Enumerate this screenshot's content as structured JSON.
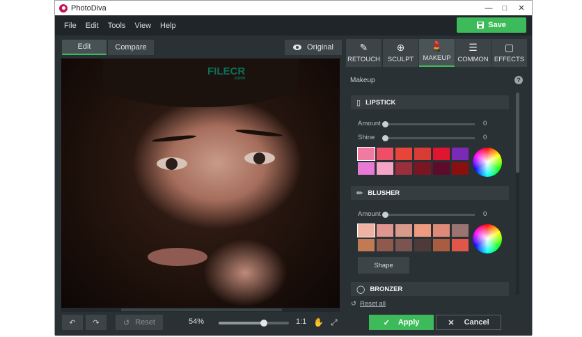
{
  "window": {
    "title": "PhotoDiva",
    "controls": [
      "minimize-icon",
      "maximize-icon",
      "close-icon"
    ]
  },
  "menu": {
    "items": [
      "File",
      "Edit",
      "Tools",
      "View",
      "Help"
    ],
    "save_label": "Save"
  },
  "view_tabs": {
    "edit": "Edit",
    "compare": "Compare",
    "original": "Original"
  },
  "watermark": {
    "text": "FILECR",
    "sub": ".com"
  },
  "bottom": {
    "reset": "Reset",
    "zoom": "54%",
    "zoom_level": 0.54,
    "ratio": "1:1"
  },
  "tool_tabs": [
    {
      "label": "RETOUCH",
      "icon": "retouch-icon"
    },
    {
      "label": "SCULPT",
      "icon": "sculpt-icon"
    },
    {
      "label": "MAKEUP",
      "icon": "makeup-icon"
    },
    {
      "label": "COMMON",
      "icon": "sliders-icon"
    },
    {
      "label": "EFFECTS",
      "icon": "effects-icon"
    }
  ],
  "panel": {
    "title": "Makeup",
    "lipstick": {
      "title": "LIPSTICK",
      "amount_label": "Amount",
      "amount_value": "0",
      "shine_label": "Shine",
      "shine_value": "0",
      "colors": [
        "#f07aa0",
        "#ef4f66",
        "#e8453a",
        "#d93b35",
        "#e01630",
        "#7b2ab8",
        "#e87ad6",
        "#f5a3c7",
        "#9a2e3d",
        "#7a1622",
        "#5e0b2a",
        "#8a1010"
      ]
    },
    "blusher": {
      "title": "BLUSHER",
      "amount_label": "Amount",
      "amount_value": "0",
      "colors": [
        "#eeb3a3",
        "#e0958f",
        "#d99a8c",
        "#ee9a7f",
        "#dd8a78",
        "#9a7470",
        "#c27a55",
        "#8f5a4d",
        "#7a5550",
        "#4f3a3a",
        "#a85c40",
        "#e0564a"
      ],
      "shape_label": "Shape"
    },
    "bronzer": {
      "title": "BRONZER"
    },
    "reset_all": "Reset all"
  },
  "actions": {
    "apply": "Apply",
    "cancel": "Cancel"
  },
  "colors": {
    "accent": "#3dbb5b",
    "bg": "#2a3134"
  }
}
